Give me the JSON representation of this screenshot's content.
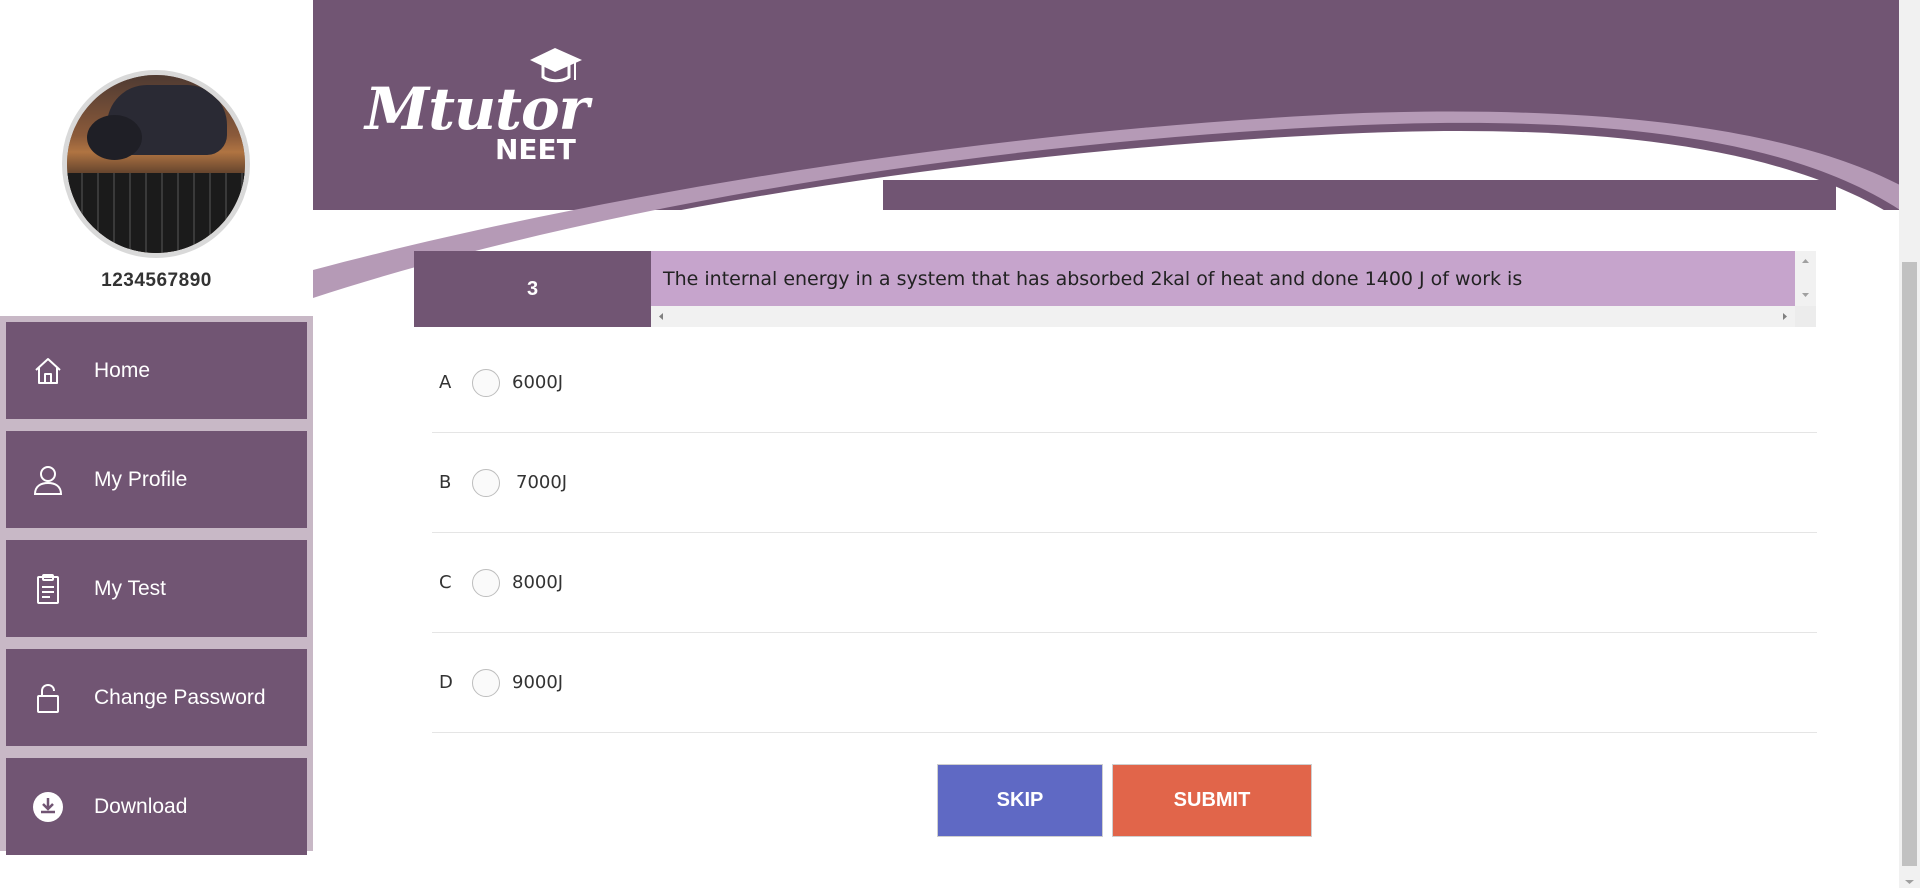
{
  "user": {
    "phone": "1234567890"
  },
  "sidebar": {
    "items": [
      {
        "label": "Home",
        "icon": "home-icon"
      },
      {
        "label": "My Profile",
        "icon": "user-icon"
      },
      {
        "label": "My Test",
        "icon": "clipboard-icon"
      },
      {
        "label": "Change Password",
        "icon": "lock-icon"
      },
      {
        "label": "Download",
        "icon": "download-icon"
      }
    ]
  },
  "header": {
    "logo_main": "Mtutor",
    "logo_sub": "NEET"
  },
  "question": {
    "number": "3",
    "text": "The internal energy in a system that has absorbed 2kal of heat and done 1400 J of work is"
  },
  "options": [
    {
      "letter": "A",
      "text": "6000J"
    },
    {
      "letter": "B",
      "text": "7000J"
    },
    {
      "letter": "C",
      "text": "8000J"
    },
    {
      "letter": "D",
      "text": "9000J"
    }
  ],
  "actions": {
    "skip_label": "SKIP",
    "submit_label": "SUBMIT"
  },
  "colors": {
    "primary_purple": "#715573",
    "question_bg": "#c6a4cc",
    "skip_button": "#5f69c4",
    "submit_button": "#e1654a"
  }
}
